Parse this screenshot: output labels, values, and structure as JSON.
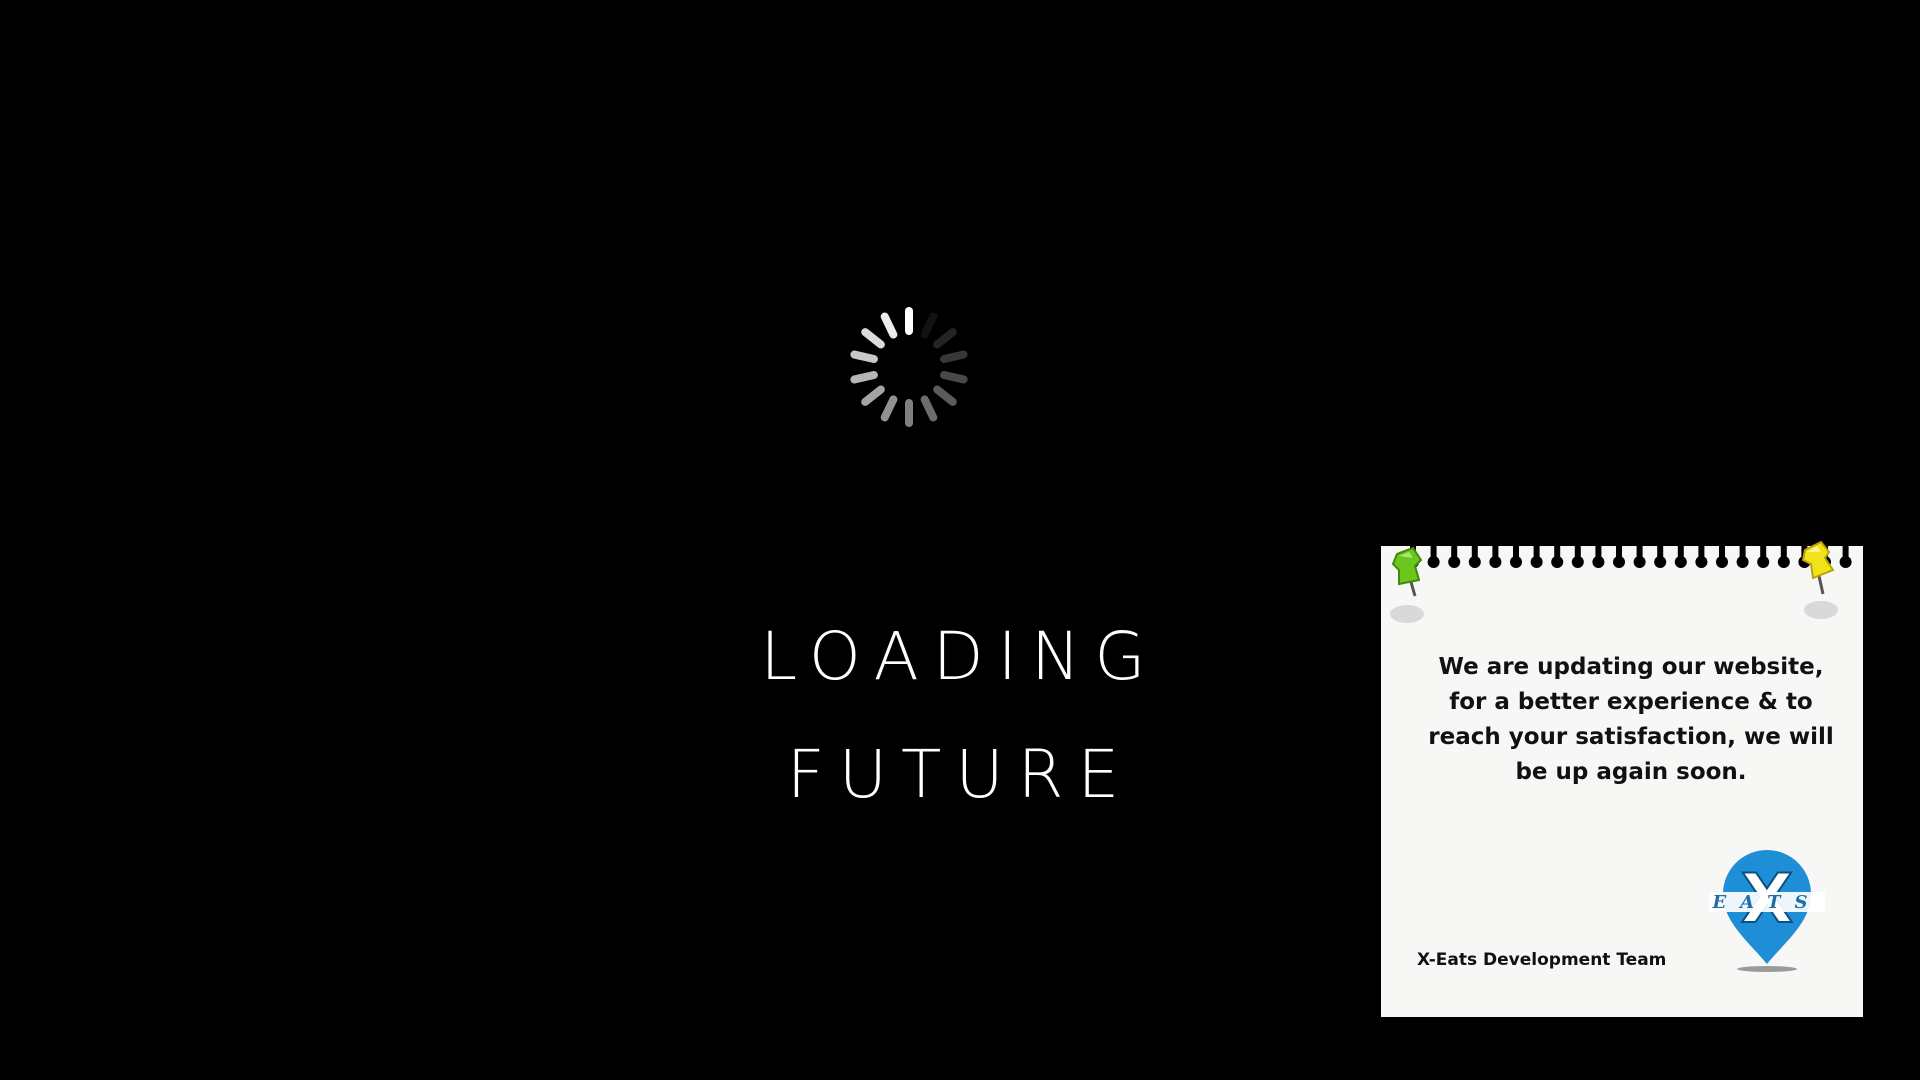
{
  "headline": {
    "line1": "LOADING",
    "line2": "FUTURE"
  },
  "spinner": {
    "icon": "loading-spinner-icon",
    "color": "#ffffff"
  },
  "notice": {
    "message": "We are updating our website, for a better experience & to reach your satisfaction, we will be up again soon.",
    "signature": "X-Eats Development Team",
    "logo_letter": "X",
    "logo_word": "EATS",
    "logo_color": "#1e8fd6",
    "pin_colors": [
      "#6cc61e",
      "#f2e21a"
    ],
    "paper_color": "#f7f7f5"
  }
}
